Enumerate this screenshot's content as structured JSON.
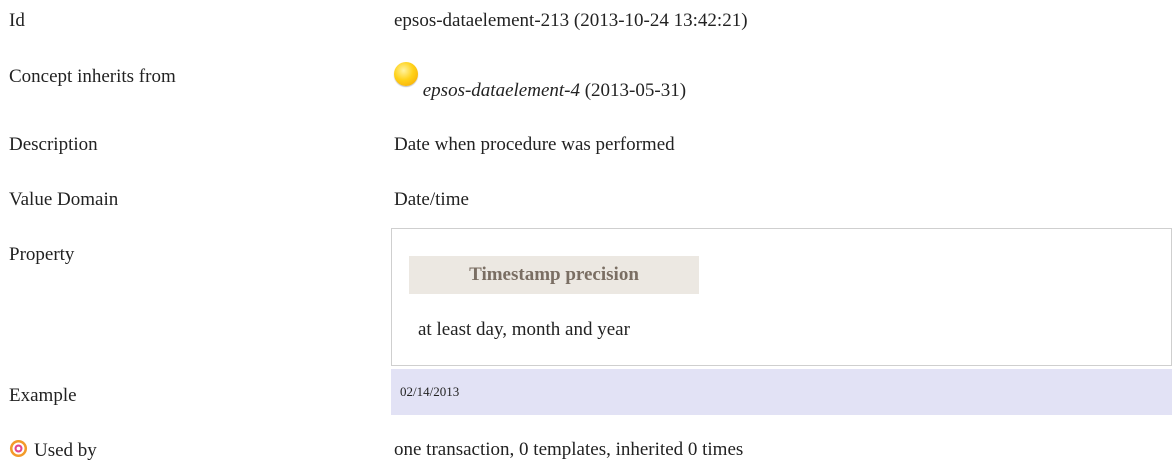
{
  "rows": {
    "id": {
      "label": "Id",
      "value": "epsos-dataelement-213 (2013-10-24 13:42:21)"
    },
    "inherits": {
      "label": "Concept inherits from",
      "ref": "epsos-dataelement-4",
      "date": "(2013-05-31)"
    },
    "description": {
      "label": "Description",
      "value": "Date when procedure was performed"
    },
    "value_domain": {
      "label": "Value Domain",
      "value": "Date/time"
    },
    "property": {
      "label": "Property",
      "header": "Timestamp precision",
      "value": "at least day, month and year"
    },
    "example": {
      "label": "Example",
      "value": "02/14/2013"
    },
    "used_by": {
      "label": "Used by",
      "value": "one transaction, 0 templates, inherited 0 times"
    }
  },
  "colors": {
    "property_header_bg": "#ece8e2",
    "example_bg": "#e2e2f5",
    "orb": "#ffd21a"
  }
}
